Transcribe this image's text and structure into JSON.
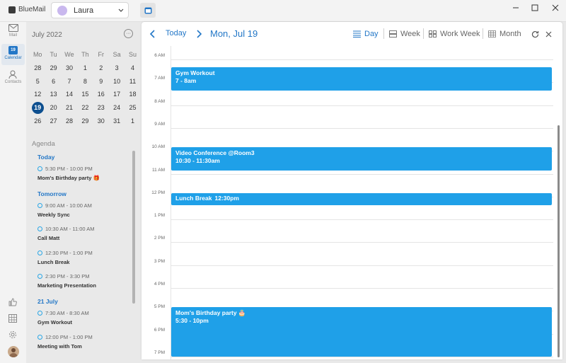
{
  "app": {
    "name": "BlueMail",
    "account": "Laura"
  },
  "nav": [
    {
      "id": "mail",
      "label": "Mail"
    },
    {
      "id": "calendar",
      "label": "Calendar",
      "badge": "19"
    },
    {
      "id": "contacts",
      "label": "Contacts"
    }
  ],
  "mini_calendar": {
    "title": "July 2022",
    "weekdays": [
      "Mo",
      "Tu",
      "We",
      "Th",
      "Fr",
      "Sa",
      "Su"
    ],
    "weeks": [
      [
        "28",
        "29",
        "30",
        "1",
        "2",
        "3",
        "4"
      ],
      [
        "5",
        "6",
        "7",
        "8",
        "9",
        "10",
        "11"
      ],
      [
        "12",
        "13",
        "14",
        "15",
        "16",
        "17",
        "18"
      ],
      [
        "19",
        "20",
        "21",
        "22",
        "23",
        "24",
        "25"
      ],
      [
        "26",
        "27",
        "28",
        "29",
        "30",
        "31",
        "1"
      ]
    ],
    "today": "19"
  },
  "agenda": {
    "title": "Agenda",
    "groups": [
      {
        "day": "Today",
        "items": [
          {
            "time": "5:30 PM - 10:00 PM",
            "name": "Mom's Birthday party 🎁"
          }
        ]
      },
      {
        "day": "Tomorrow",
        "items": [
          {
            "time": "9:00 AM - 10:00 AM",
            "name": "Weekly Sync"
          },
          {
            "time": "10:30 AM - 11:00 AM",
            "name": "Call Matt"
          },
          {
            "time": "12:30 PM - 1:00 PM",
            "name": "Lunch Break"
          },
          {
            "time": "2:30 PM - 3:30 PM",
            "name": "Marketing Presentation"
          }
        ]
      },
      {
        "day": "21 July",
        "items": [
          {
            "time": "7:30 AM - 8:30 AM",
            "name": "Gym Workout"
          },
          {
            "time": "12:00 PM - 1:00 PM",
            "name": "Meeting with Tom"
          }
        ]
      }
    ]
  },
  "toolbar": {
    "today_label": "Today",
    "date_label": "Mon, Jul 19",
    "views": [
      {
        "label": "Day",
        "active": true,
        "icon": "list-icon"
      },
      {
        "label": "Week",
        "active": false,
        "icon": "week-icon"
      },
      {
        "label": "Work Week",
        "active": false,
        "icon": "grid-icon"
      },
      {
        "label": "Month",
        "active": false,
        "icon": "month-icon"
      }
    ]
  },
  "hours": [
    "6 AM",
    "7 AM",
    "8 AM",
    "9 AM",
    "10 AM",
    "11 AM",
    "12 PM",
    "1 PM",
    "2 PM",
    "3 PM",
    "4 PM",
    "5 PM",
    "6 PM",
    "7 PM"
  ],
  "events": [
    {
      "title": "Gym Workout",
      "time": "7 - 8am",
      "layout": "stacked"
    },
    {
      "title": "Video Conference @Room3",
      "time": "10:30 - 11:30am",
      "layout": "stacked"
    },
    {
      "title": "Lunch Break",
      "time": "12:30pm",
      "layout": "inline"
    },
    {
      "title": "Mom's Birthday party 🎂",
      "time": "5:30 - 10pm",
      "layout": "stacked"
    }
  ],
  "colors": {
    "accent": "#2377c7",
    "event": "#1fa0e8",
    "today_circle": "#0d4f8f"
  }
}
